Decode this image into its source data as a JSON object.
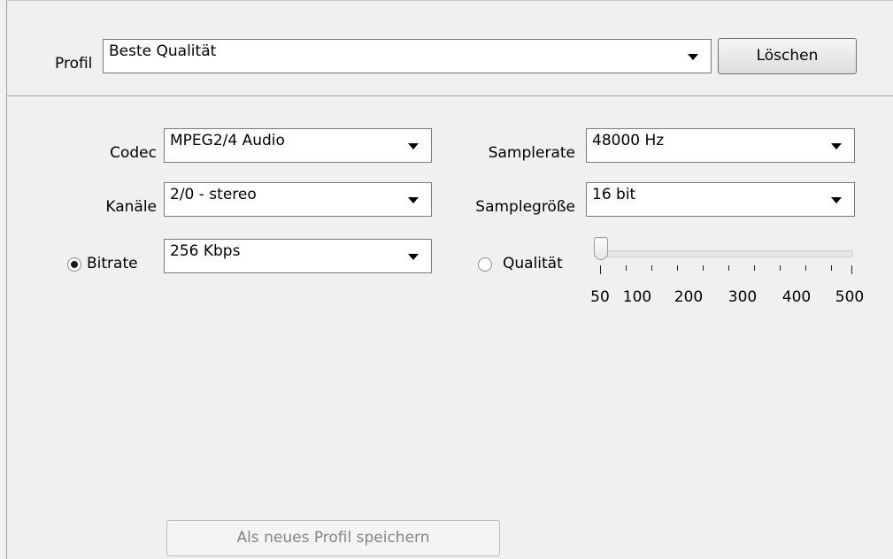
{
  "profile": {
    "label": "Profil",
    "selected": "Beste Qualität",
    "delete_button": "Löschen"
  },
  "settings": {
    "codec_label": "Codec",
    "codec_value": "MPEG2/4 Audio",
    "channels_label": "Kanäle",
    "channels_value": "2/0 - stereo",
    "bitrate_label": "Bitrate",
    "bitrate_value": "256 Kbps",
    "bitrate_selected": true,
    "samplerate_label": "Samplerate",
    "samplerate_value": "48000 Hz",
    "samplesize_label": "Samplegröße",
    "samplesize_value": "16 bit",
    "quality_label": "Qualität",
    "quality_selected": false
  },
  "quality_slider": {
    "ticks": [
      "50",
      "100",
      "200",
      "300",
      "400",
      "500"
    ],
    "value_fraction": 0.0
  },
  "footer": {
    "save_button": "Als neues Profil speichern"
  }
}
